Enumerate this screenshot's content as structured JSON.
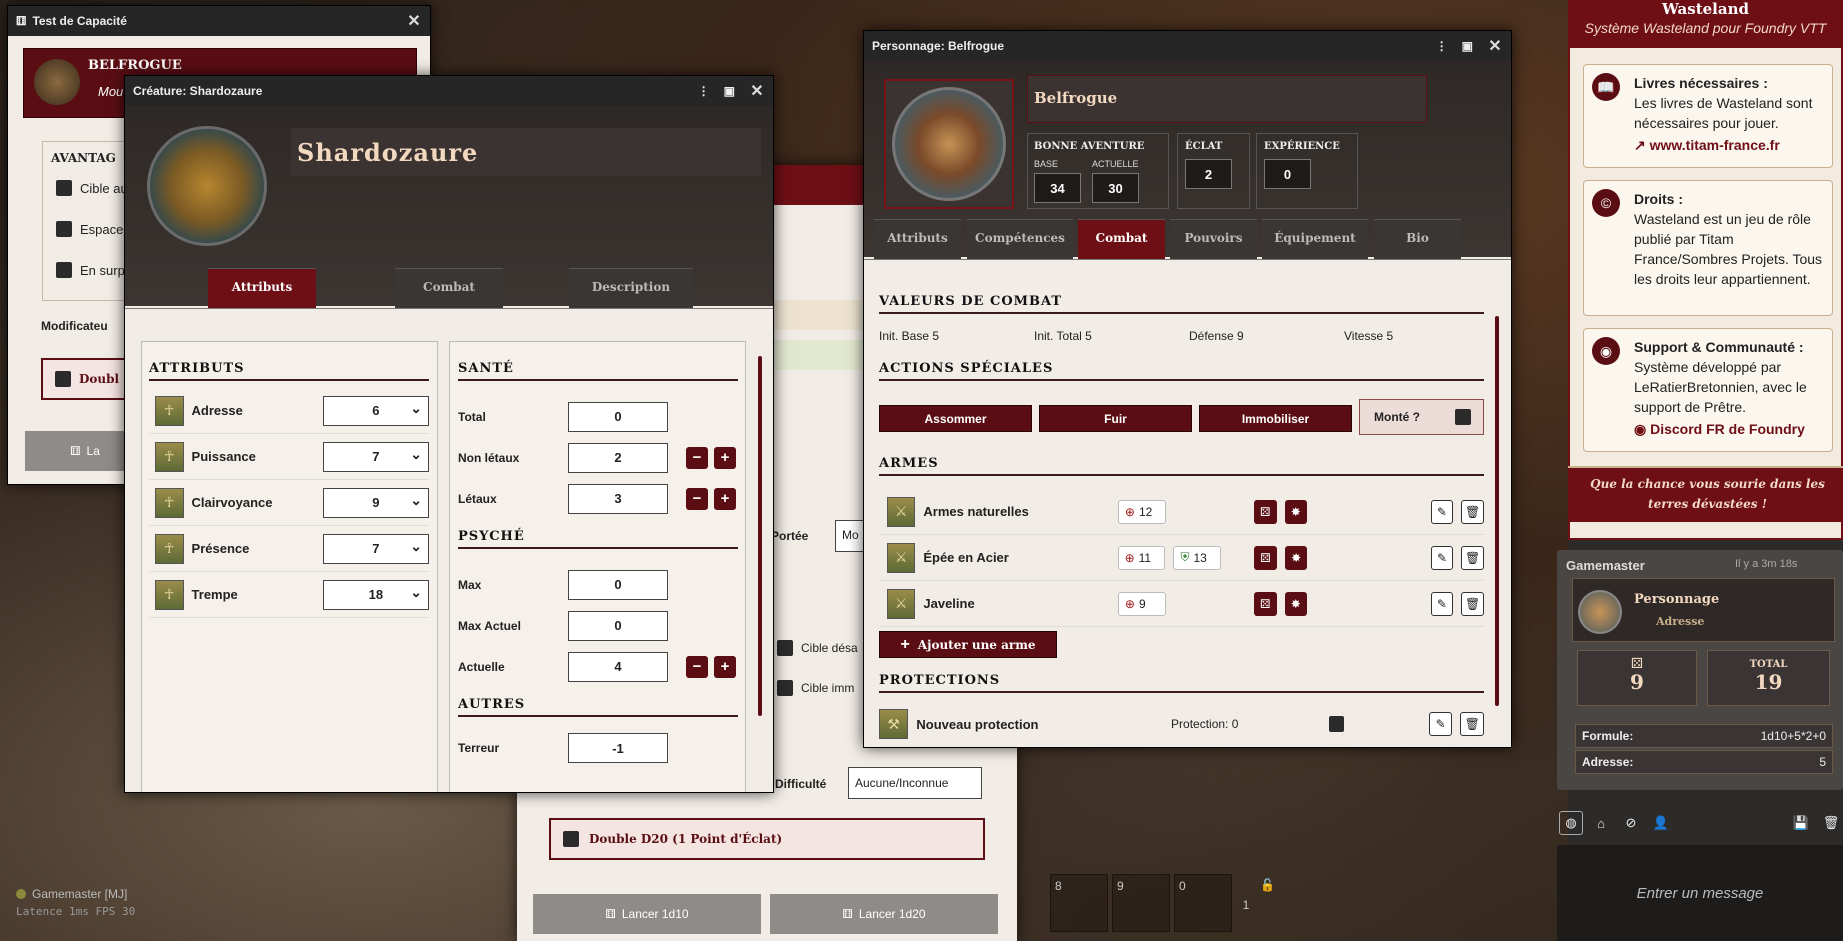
{
  "test_window": {
    "title": "Test de Capacité",
    "actor_name": "BELFROGUE",
    "actor_sub": "Mou",
    "advantages_title": "AVANTAG",
    "checks": [
      "Cible au",
      "Espace",
      "En surp"
    ],
    "modifier_label": "Modificateu",
    "double_label": "Doubl",
    "launch_partial": "La",
    "portee_label": "Portée",
    "portee_value": "Mo",
    "cible_labels": [
      "Cible désa",
      "Cible imm"
    ],
    "difficulte_label": "Difficulté",
    "difficulte_value": "Aucune/Inconnue",
    "double_d20": "Double D20 (1 Point d'Éclat)",
    "launch_1d10": "Lancer 1d10",
    "launch_1d20": "Lancer 1d20"
  },
  "creature": {
    "title": "Créature: Shardozaure",
    "name": "Shardozaure",
    "tabs": [
      "Attributs",
      "Combat",
      "Description"
    ],
    "attr_title": "ATTRIBUTS",
    "attributes": [
      {
        "label": "Adresse",
        "value": "6"
      },
      {
        "label": "Puissance",
        "value": "7"
      },
      {
        "label": "Clairvoyance",
        "value": "9"
      },
      {
        "label": "Présence",
        "value": "7"
      },
      {
        "label": "Trempe",
        "value": "18"
      }
    ],
    "sante_title": "SANTÉ",
    "sante": [
      {
        "label": "Total",
        "value": "0"
      },
      {
        "label": "Non létaux",
        "value": "2"
      },
      {
        "label": "Létaux",
        "value": "3"
      }
    ],
    "psyche_title": "PSYCHÉ",
    "psyche": [
      {
        "label": "Max",
        "value": "0"
      },
      {
        "label": "Max Actuel",
        "value": "0"
      },
      {
        "label": "Actuelle",
        "value": "4"
      }
    ],
    "autres_title": "AUTRES",
    "terreur_label": "Terreur",
    "terreur_value": "-1"
  },
  "perso": {
    "title": "Personnage: Belfrogue",
    "name": "Belfrogue",
    "bonne_aventure": "BONNE AVENTURE",
    "base_label": "BASE",
    "base_value": "34",
    "actuelle_label": "ACTUELLE",
    "actuelle_value": "30",
    "eclat_label": "ÉCLAT",
    "eclat_value": "2",
    "xp_label": "EXPÉRIENCE",
    "xp_value": "0",
    "tabs": [
      "Attributs",
      "Compétences",
      "Combat",
      "Pouvoirs",
      "Équipement",
      "Bio"
    ],
    "combat_title": "VALEURS DE COMBAT",
    "combat_values": [
      "Init. Base 5",
      "Init. Total 5",
      "Défense 9",
      "Vitesse 5"
    ],
    "actions_title": "ACTIONS SPÉCIALES",
    "actions": [
      "Assommer",
      "Fuir",
      "Immobiliser"
    ],
    "monte_label": "Monté ?",
    "armes_title": "ARMES",
    "weapons": [
      {
        "name": "Armes naturelles",
        "att": "12",
        "def": ""
      },
      {
        "name": "Épée en Acier",
        "att": "11",
        "def": "13"
      },
      {
        "name": "Javeline",
        "att": "9",
        "def": ""
      }
    ],
    "add_weapon": "Ajouter une arme",
    "protections_title": "PROTECTIONS",
    "protection_name": "Nouveau protection",
    "protection_value": "Protection: 0"
  },
  "sidebar": {
    "title": "Wasteland",
    "subtitle": "Système Wasteland pour Foundry VTT",
    "cards": [
      {
        "title": "Livres nécessaires :",
        "text": "Les livres de Wasteland sont nécessaires pour jouer.",
        "link": "www.titam-france.fr"
      },
      {
        "title": "Droits :",
        "text": "Wasteland est un jeu de rôle publié par Titam France/Sombres Projets. Tous les droits leur appartiennent.",
        "link": ""
      },
      {
        "title": "Support & Communauté :",
        "text": "Système développé par LeRatierBretonnien, avec le support de Prêtre.",
        "link": "Discord FR de Foundry"
      }
    ],
    "footer": "Que la chance vous sourie dans les terres dévastées !",
    "msg_author": "Gamemaster",
    "msg_time": "Il y a 3m 18s",
    "msg_type": "Personnage",
    "msg_attr": "Adresse",
    "msg_die": "9",
    "msg_total_label": "TOTAL",
    "msg_total": "19",
    "formule_label": "Formule:",
    "formule_value": "1d10+5*2+0",
    "adresse_label": "Adresse:",
    "adresse_value": "5",
    "chat_placeholder": "Entrer un message"
  },
  "bottom": {
    "player": "Gamemaster [MJ]",
    "latency": "Latence  1ms FPS  30",
    "hotbar": [
      "8",
      "9",
      "0"
    ],
    "hotbar_page": "1"
  }
}
